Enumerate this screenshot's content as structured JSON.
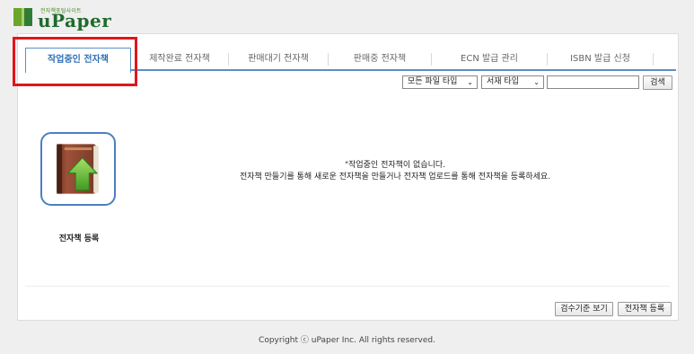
{
  "logo": {
    "small_text": "전자책포털사이트",
    "brand": "uPaper"
  },
  "tabs": [
    {
      "label": "작업중인 전자책",
      "active": true
    },
    {
      "label": "제작완료 전자책",
      "active": false
    },
    {
      "label": "판매대기 전자책",
      "active": false
    },
    {
      "label": "판매중 전자책",
      "active": false
    },
    {
      "label": "ECN 발급 관리",
      "active": false
    },
    {
      "label": "ISBN 발급 신청",
      "active": false
    }
  ],
  "filters": {
    "file_type": "모든 파일 타입",
    "book_type": "서재 타입",
    "search_value": "",
    "search_button": "검색"
  },
  "register": {
    "icon": "book-upload-icon",
    "label": "전자책 등록"
  },
  "empty_message": {
    "line1": "\"작업중인 전자책이 없습니다.",
    "line2": "전자책 만들기를 통해 새로운 전자책을 만들거나 전자책 업로드를 통해 전자책을 등록하세요."
  },
  "actions": {
    "criteria_button": "검수기준 보기",
    "register_button": "전자책 등록"
  },
  "footer": {
    "copyright": "Copyright ⓒ uPaper Inc. All rights reserved."
  },
  "colors": {
    "accent": "#2f6fb5",
    "highlight": "#e0161c",
    "brand_green": "#1f6b2c"
  }
}
